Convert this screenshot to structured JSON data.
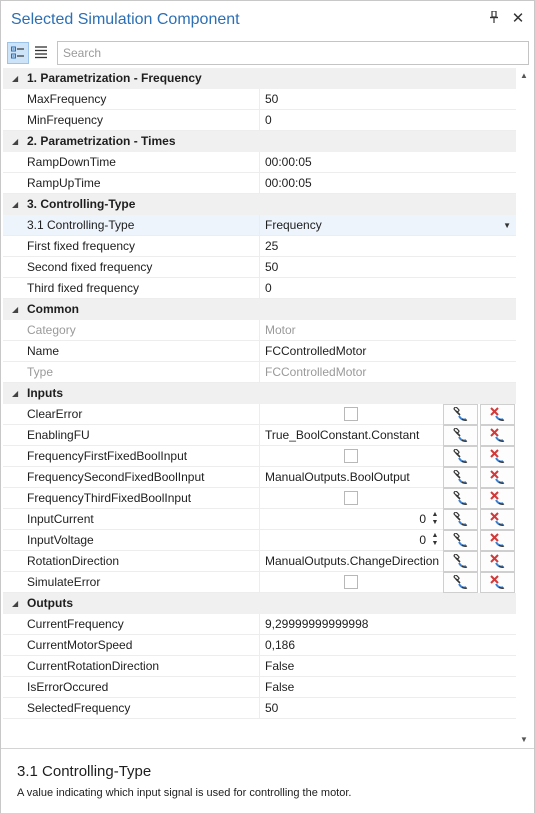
{
  "window": {
    "title": "Selected Simulation Component",
    "pin_icon": "pin-icon",
    "close_icon": "close-icon"
  },
  "toolbar": {
    "categorized_icon": "categorized-view-icon",
    "alphabetical_icon": "alphabetical-view-icon",
    "search_placeholder": "Search",
    "active_view": "categorized"
  },
  "categories": [
    {
      "name": "1. Parametrization - Frequency",
      "properties": [
        {
          "name": "MaxFrequency",
          "value": "50"
        },
        {
          "name": "MinFrequency",
          "value": "0"
        }
      ]
    },
    {
      "name": "2. Parametrization - Times",
      "properties": [
        {
          "name": "RampDownTime",
          "value": "00:00:05"
        },
        {
          "name": "RampUpTime",
          "value": "00:00:05"
        }
      ]
    },
    {
      "name": "3. Controlling-Type",
      "properties": [
        {
          "name": "3.1 Controlling-Type",
          "value": "Frequency",
          "kind": "combo",
          "selected": true
        },
        {
          "name": "First fixed frequency",
          "value": "25"
        },
        {
          "name": "Second fixed frequency",
          "value": "50"
        },
        {
          "name": "Third fixed frequency",
          "value": "0"
        }
      ]
    },
    {
      "name": "Common",
      "properties": [
        {
          "name": "Category",
          "value": "Motor",
          "disabled": true
        },
        {
          "name": "Name",
          "value": "FCControlledMotor"
        },
        {
          "name": "Type",
          "value": "FCControlledMotor",
          "disabled": true
        }
      ]
    },
    {
      "name": "Inputs",
      "properties": [
        {
          "name": "ClearError",
          "kind": "checkbox",
          "bindable": true
        },
        {
          "name": "EnablingFU",
          "value": "True_BoolConstant.Constant",
          "bindable": true
        },
        {
          "name": "FrequencyFirstFixedBoolInput",
          "kind": "checkbox",
          "bindable": true
        },
        {
          "name": "FrequencySecondFixedBoolInput",
          "value": "ManualOutputs.BoolOutput",
          "bindable": true
        },
        {
          "name": "FrequencyThirdFixedBoolInput",
          "kind": "checkbox",
          "bindable": true
        },
        {
          "name": "InputCurrent",
          "value": "0",
          "kind": "spinner",
          "bindable": true
        },
        {
          "name": "InputVoltage",
          "value": "0",
          "kind": "spinner",
          "bindable": true
        },
        {
          "name": "RotationDirection",
          "value": "ManualOutputs.ChangeDirection",
          "bindable": true
        },
        {
          "name": "SimulateError",
          "kind": "checkbox",
          "bindable": true
        }
      ]
    },
    {
      "name": "Outputs",
      "properties": [
        {
          "name": "CurrentFrequency",
          "value": "9,29999999999998"
        },
        {
          "name": "CurrentMotorSpeed",
          "value": "0,186"
        },
        {
          "name": "CurrentRotationDirection",
          "value": "False"
        },
        {
          "name": "IsErrorOccured",
          "value": "False"
        },
        {
          "name": "SelectedFrequency",
          "value": "50"
        }
      ]
    }
  ],
  "description": {
    "title": "3.1 Controlling-Type",
    "text": "A value indicating which input signal is used for controlling the motor."
  },
  "colors": {
    "title_blue": "#2c6fb5",
    "category_bg": "#f0f0f0",
    "selected_row_bg": "#edf4fb",
    "bind_icon_blue": "#3a7fd0",
    "unbind_icon_red": "#d23a3a"
  }
}
